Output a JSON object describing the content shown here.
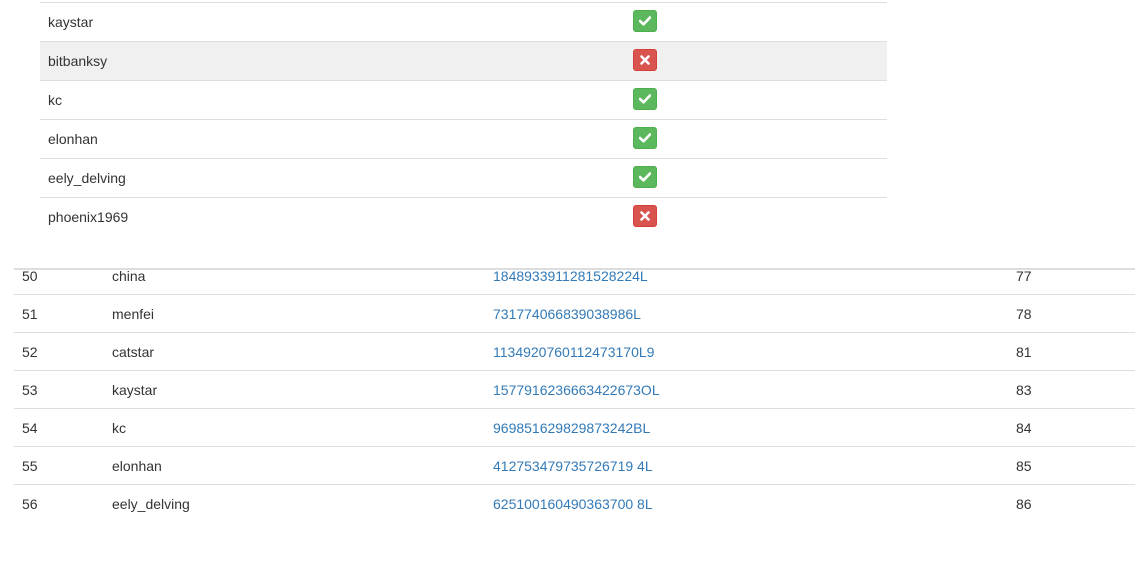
{
  "top_table": {
    "rows": [
      {
        "name": "kaystar",
        "status": "ok",
        "icon": "check-icon"
      },
      {
        "name": "bitbanksy",
        "status": "bad",
        "icon": "remove-icon"
      },
      {
        "name": "kc",
        "status": "ok",
        "icon": "check-icon"
      },
      {
        "name": "elonhan",
        "status": "ok",
        "icon": "check-icon"
      },
      {
        "name": "eely_delving",
        "status": "ok",
        "icon": "check-icon"
      },
      {
        "name": "phoenix1969",
        "status": "bad",
        "icon": "remove-icon"
      }
    ]
  },
  "bottom_table": {
    "rows": [
      {
        "idx": "50",
        "name": "china",
        "id": "1848933911281528224L",
        "value": "77"
      },
      {
        "idx": "51",
        "name": "menfei",
        "id": "731774066839038986L",
        "value": "78"
      },
      {
        "idx": "52",
        "name": "catstar",
        "id": "1134920760112473170L9",
        "value": "81"
      },
      {
        "idx": "53",
        "name": "kaystar",
        "id": "1577916236663422673OL",
        "value": "83"
      },
      {
        "idx": "54",
        "name": "kc",
        "id": "969851629829873242BL",
        "value": "84"
      },
      {
        "idx": "55",
        "name": "elonhan",
        "id": "412753479735726719 4L",
        "value": "85"
      },
      {
        "idx": "56",
        "name": "eely_delving",
        "id": "625100160490363700 8L",
        "value": "86"
      }
    ]
  },
  "colors": {
    "success": "#5cb85c",
    "danger": "#d9534f",
    "link": "#337ab7",
    "row_highlight": "#f0f0f0"
  }
}
